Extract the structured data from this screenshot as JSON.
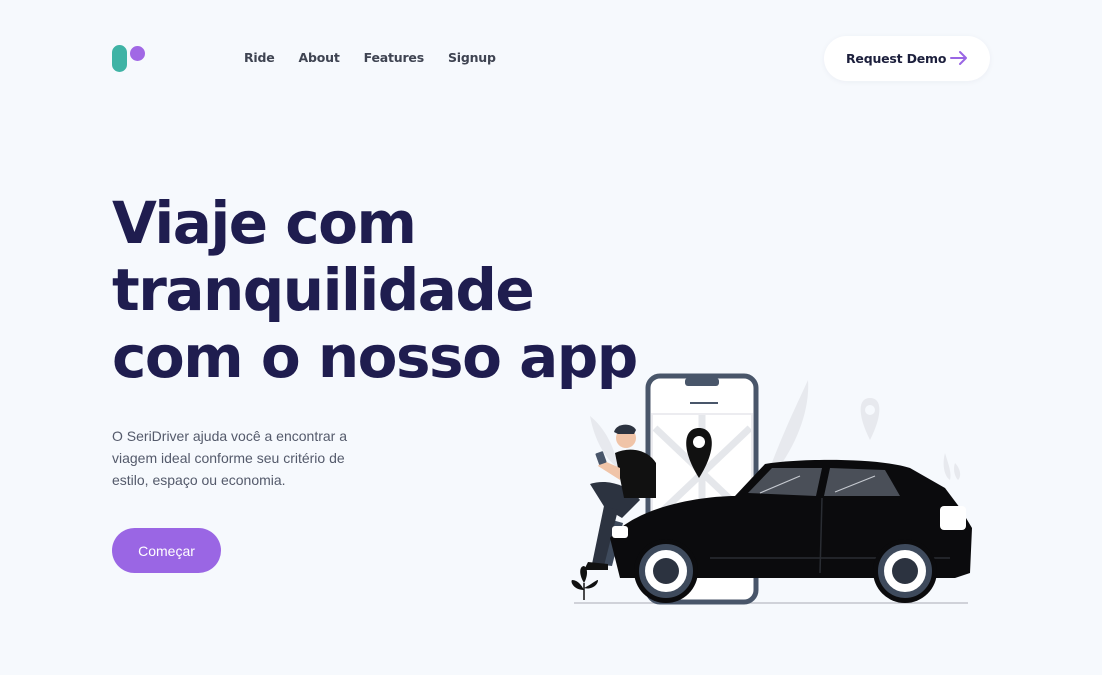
{
  "nav": {
    "items": [
      {
        "label": "Ride"
      },
      {
        "label": "About"
      },
      {
        "label": "Features"
      },
      {
        "label": "Signup"
      }
    ]
  },
  "header": {
    "demo_label": "Request Demo"
  },
  "hero": {
    "title_lines": [
      "Viaje com",
      "tranquilidade",
      "com o nosso app"
    ],
    "description": "O SeriDriver ajuda você a encontrar a viagem ideal conforme seu critério de estilo, espaço ou economia.",
    "cta_label": "Começar"
  },
  "colors": {
    "background": "#f6f9fd",
    "heading": "#1f1d4f",
    "accent": "#9a66e4",
    "logo_teal": "#3fb3a5",
    "logo_purple": "#a168e5"
  },
  "icons": [
    "logo-mark",
    "arrow-right-icon",
    "map-pin-icon",
    "smartphone",
    "car",
    "person",
    "plant"
  ]
}
